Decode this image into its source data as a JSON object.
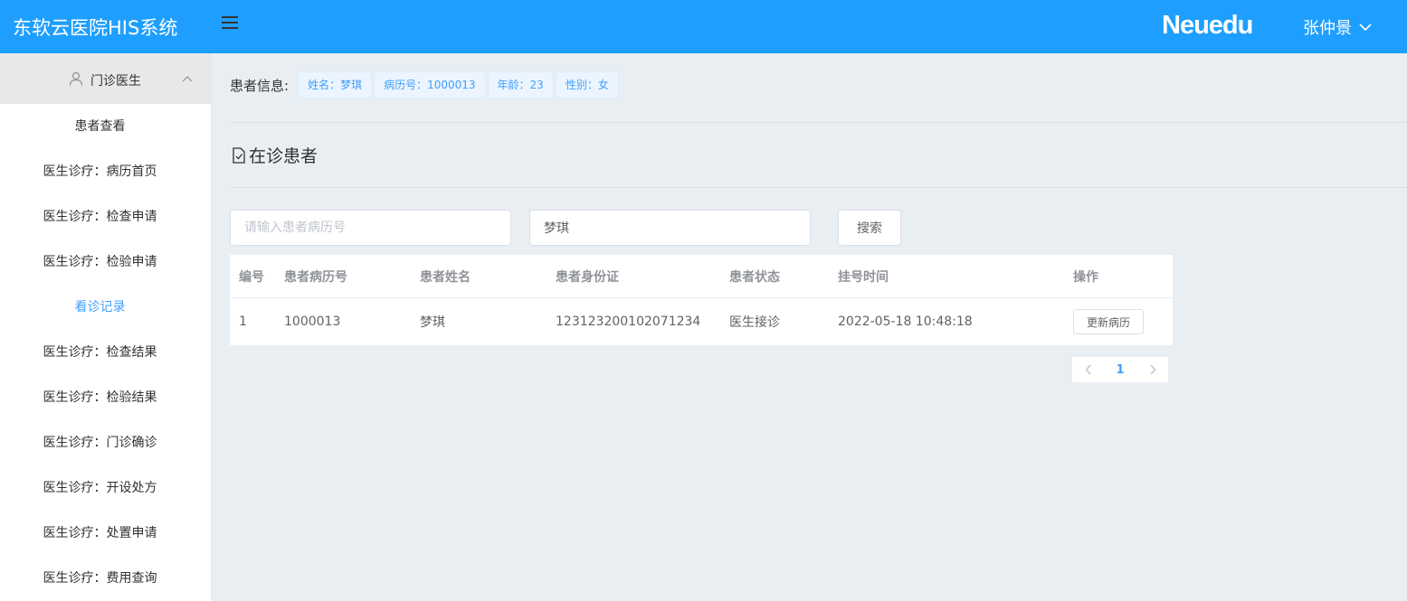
{
  "header": {
    "app_title": "东软云医院HIS系统",
    "brand": "Neuedu",
    "user_name": "张仲景",
    "accent_color": "#1e9fff",
    "icons": [
      "menu-icon",
      "chevron-down-icon"
    ]
  },
  "sidebar": {
    "group_label": "门诊医生",
    "group_icons": [
      "user-icon",
      "chevron-up-icon"
    ],
    "items": [
      {
        "label": "患者查看",
        "active": false
      },
      {
        "label": "医生诊疗：病历首页",
        "active": false
      },
      {
        "label": "医生诊疗：检查申请",
        "active": false
      },
      {
        "label": "医生诊疗：检验申请",
        "active": false
      },
      {
        "label": "看诊记录",
        "active": true
      },
      {
        "label": "医生诊疗：检查结果",
        "active": false
      },
      {
        "label": "医生诊疗：检验结果",
        "active": false
      },
      {
        "label": "医生诊疗：门诊确诊",
        "active": false
      },
      {
        "label": "医生诊疗：开设处方",
        "active": false
      },
      {
        "label": "医生诊疗：处置申请",
        "active": false
      },
      {
        "label": "医生诊疗：费用查询",
        "active": false
      }
    ]
  },
  "patient_info": {
    "label": "患者信息:",
    "tags": [
      "姓名：梦琪",
      "病历号：1000013",
      "年龄：23",
      "性别：女"
    ]
  },
  "section": {
    "title": "在诊患者",
    "icon": "document-check-icon"
  },
  "search": {
    "record_placeholder": "请输入患者病历号",
    "record_value": "",
    "name_value": "梦琪",
    "button_label": "搜索"
  },
  "table": {
    "columns": [
      "编号",
      "患者病历号",
      "患者姓名",
      "患者身份证",
      "患者状态",
      "挂号时间",
      "操作"
    ],
    "rows": [
      {
        "no": "1",
        "record_no": "1000013",
        "name": "梦琪",
        "id_card": "123123200102071234",
        "status": "医生接诊",
        "reg_time": "2022-05-18 10:48:18",
        "action": "更新病历"
      }
    ]
  },
  "pagination": {
    "current_page": "1",
    "icons": [
      "chevron-left-icon",
      "chevron-right-icon"
    ]
  }
}
